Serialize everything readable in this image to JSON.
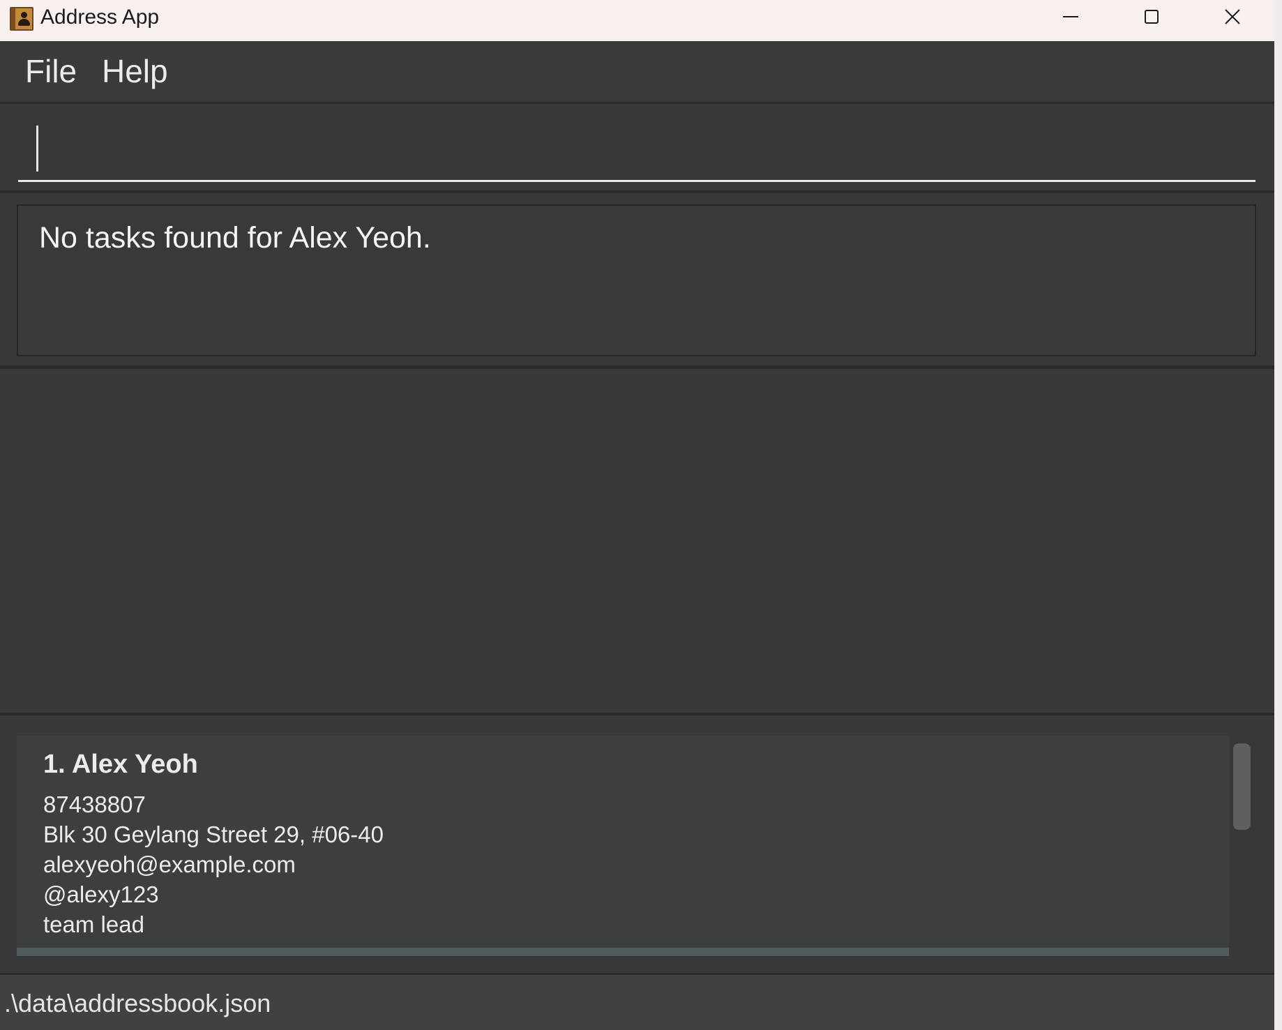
{
  "window": {
    "title": "Address App",
    "icon": "address-book-icon"
  },
  "window_controls": {
    "minimize_icon": "minimize-icon",
    "maximize_icon": "maximize-icon",
    "close_icon": "close-icon"
  },
  "menu": {
    "items": [
      {
        "label": "File"
      },
      {
        "label": "Help"
      }
    ]
  },
  "command_box": {
    "value": "",
    "placeholder": ""
  },
  "result_display": {
    "message": "No tasks found for Alex Yeoh."
  },
  "person_list": {
    "persons": [
      {
        "index_name": "1. Alex Yeoh",
        "phone": "87438807",
        "address": "Blk 30 Geylang Street 29, #06-40",
        "email": "alexyeoh@example.com",
        "handle": "@alexy123",
        "role": "team lead"
      }
    ]
  },
  "status_bar": {
    "file_path": ".\\data\\addressbook.json"
  },
  "colors": {
    "background": "#383838",
    "card": "#3c3e40",
    "text": "#ececec",
    "title_bar": "#f8f1ef"
  }
}
